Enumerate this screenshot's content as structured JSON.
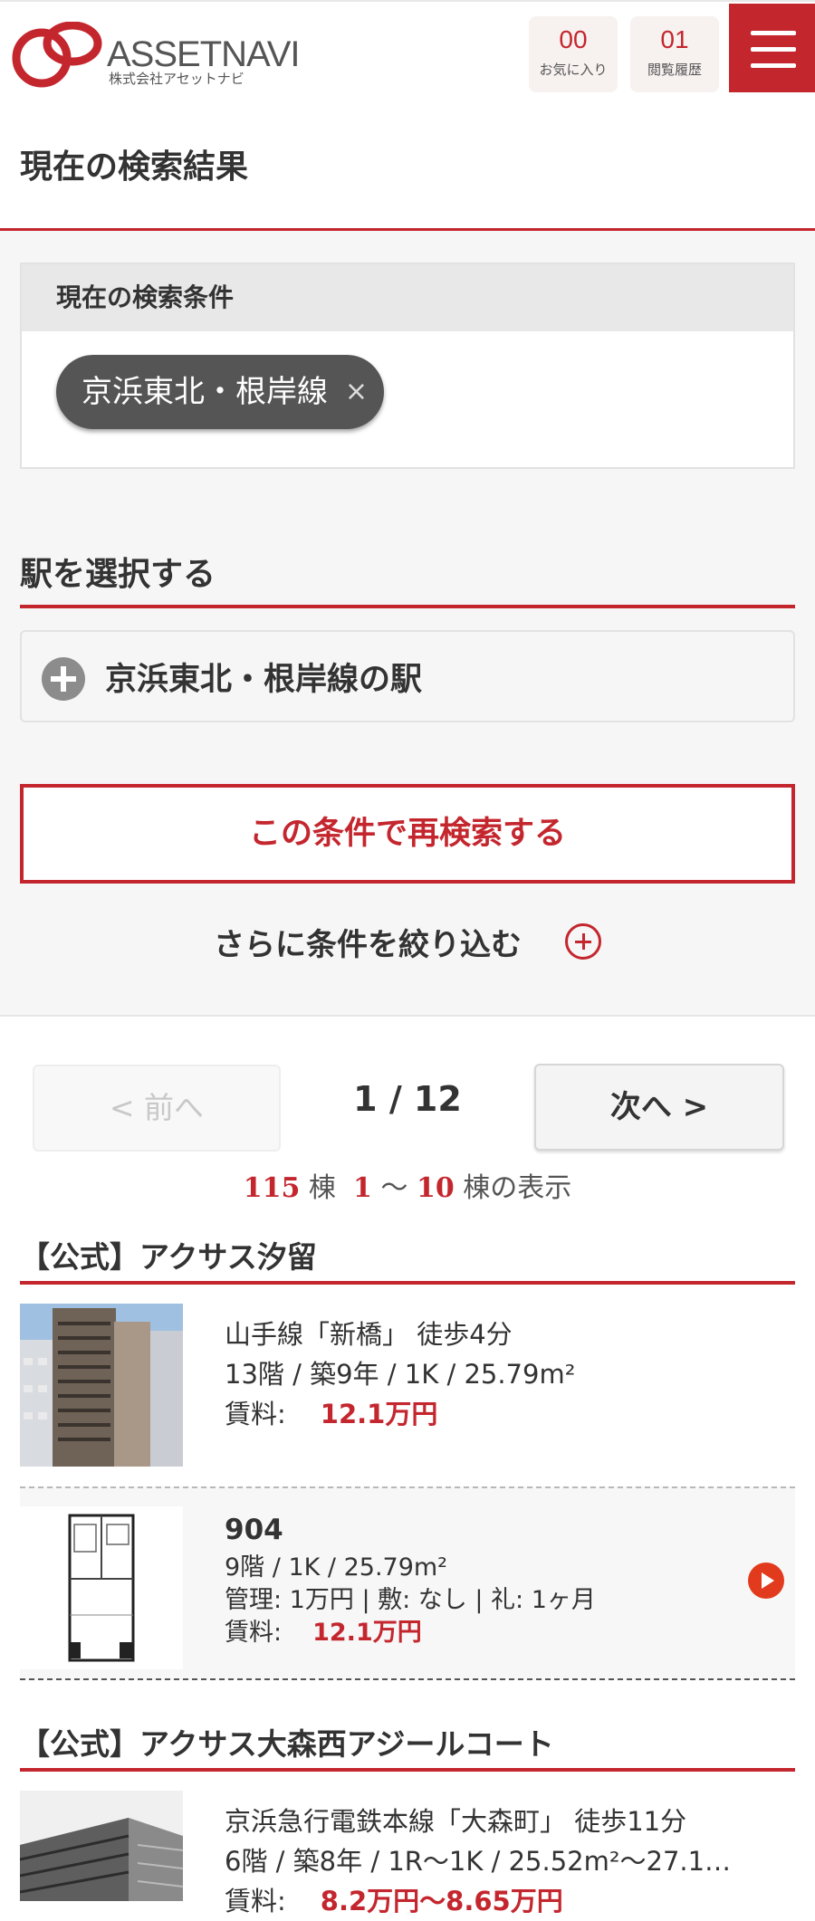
{
  "header": {
    "logo_text": "ASSETNAVI",
    "logo_sub": "株式会社アセットナビ",
    "favorites": {
      "count": "00",
      "label": "お気に入り"
    },
    "history": {
      "count": "01",
      "label": "閲覧履歴"
    },
    "menu_icon": "hamburger-menu-icon"
  },
  "page_title": "現在の検索結果",
  "conditions": {
    "heading": "現在の検索条件",
    "chip_label": "京浜東北・根岸線",
    "chip_remove": "×"
  },
  "station": {
    "heading": "駅を選択する",
    "toggle_label": "京浜東北・根岸線の駅"
  },
  "research_button": "この条件で再検索する",
  "narrow_button": "さらに条件を絞り込む",
  "pager": {
    "prev": "< 前へ",
    "info": "1 / 12",
    "next": "次へ >"
  },
  "result_count": {
    "total": "115",
    "unit1": "棟",
    "from": "1",
    "tilde": "〜",
    "to": "10",
    "suffix": "棟の表示"
  },
  "properties": [
    {
      "title": "【公式】アクサス汐留",
      "access": "山手線「新橋」 徒歩4分",
      "spec": "13階 / 築9年 / 1K / 25.79m²",
      "rent_label": "賃料:",
      "rent": "12.1万円",
      "rooms": [
        {
          "number": "904",
          "spec": "9階 / 1K / 25.79m²",
          "fees": "管理: 1万円 |  敷: なし |  礼: 1ヶ月",
          "rent_label": "賃料:",
          "rent": "12.1万円"
        }
      ]
    },
    {
      "title": "【公式】アクサス大森西アジールコート",
      "access": "京浜急行電鉄本線「大森町」 徒歩11分",
      "spec": "6階 / 築8年 / 1R〜1K / 25.52m²〜27.1…",
      "rent_label": "賃料:",
      "rent": "8.2万円〜8.65万円"
    }
  ],
  "colors": {
    "accent": "#c4262e",
    "chip_bg": "#555555",
    "section_bg": "#f6f6f6"
  }
}
